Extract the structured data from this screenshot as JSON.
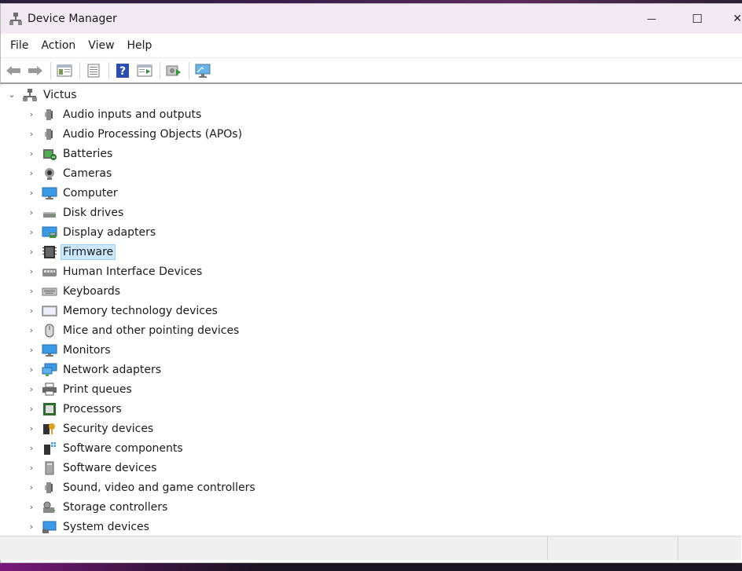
{
  "window": {
    "title": "Device Manager",
    "controls": {
      "minimize": "—",
      "maximize": "☐",
      "close": "✕"
    }
  },
  "menubar": {
    "items": [
      "File",
      "Action",
      "View",
      "Help"
    ]
  },
  "toolbar": {
    "buttons": [
      "back-icon",
      "forward-icon",
      "properties-pane-icon",
      "list-icon",
      "help-icon",
      "action-pane-icon",
      "update-driver-icon",
      "monitor-scan-icon"
    ]
  },
  "tree": {
    "root": "Victus",
    "children": [
      {
        "label": "Audio inputs and outputs",
        "icon": "speaker-icon"
      },
      {
        "label": "Audio Processing Objects (APOs)",
        "icon": "speaker-icon"
      },
      {
        "label": "Batteries",
        "icon": "battery-icon"
      },
      {
        "label": "Cameras",
        "icon": "camera-icon"
      },
      {
        "label": "Computer",
        "icon": "computer-icon"
      },
      {
        "label": "Disk drives",
        "icon": "disk-icon"
      },
      {
        "label": "Display adapters",
        "icon": "display-adapter-icon"
      },
      {
        "label": "Firmware",
        "icon": "firmware-icon",
        "selected": true
      },
      {
        "label": "Human Interface Devices",
        "icon": "hid-icon"
      },
      {
        "label": "Keyboards",
        "icon": "keyboard-icon"
      },
      {
        "label": "Memory technology devices",
        "icon": "memory-icon"
      },
      {
        "label": "Mice and other pointing devices",
        "icon": "mouse-icon"
      },
      {
        "label": "Monitors",
        "icon": "monitor-icon"
      },
      {
        "label": "Network adapters",
        "icon": "network-icon"
      },
      {
        "label": "Print queues",
        "icon": "printer-icon"
      },
      {
        "label": "Processors",
        "icon": "processor-icon"
      },
      {
        "label": "Security devices",
        "icon": "security-icon"
      },
      {
        "label": "Software components",
        "icon": "software-component-icon"
      },
      {
        "label": "Software devices",
        "icon": "software-device-icon"
      },
      {
        "label": "Sound, video and game controllers",
        "icon": "speaker-icon"
      },
      {
        "label": "Storage controllers",
        "icon": "storage-icon"
      },
      {
        "label": "System devices",
        "icon": "system-icon"
      }
    ]
  },
  "colors": {
    "selection_bg": "#cce8ff",
    "selection_border": "#99d1ff",
    "titlebar_bg": "#f3e9f4"
  }
}
